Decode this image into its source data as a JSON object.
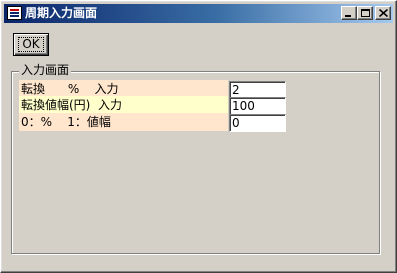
{
  "window": {
    "title": "周期入力画面"
  },
  "toolbar": {
    "ok_label": "OK"
  },
  "group": {
    "label": "入力画面",
    "rows": [
      {
        "label": "転換      %    入力",
        "value": "2",
        "bg": "#ffe6cc"
      },
      {
        "label": "転換値幅(円)  入力",
        "value": "100",
        "bg": "#ffffcc"
      },
      {
        "label": "0：%    1：値幅",
        "value": "0",
        "bg": "#ffe6cc"
      }
    ]
  },
  "icons": {
    "app": "app-window-icon",
    "minimize": "minimize-icon",
    "maximize": "maximize-icon",
    "close": "close-icon"
  }
}
